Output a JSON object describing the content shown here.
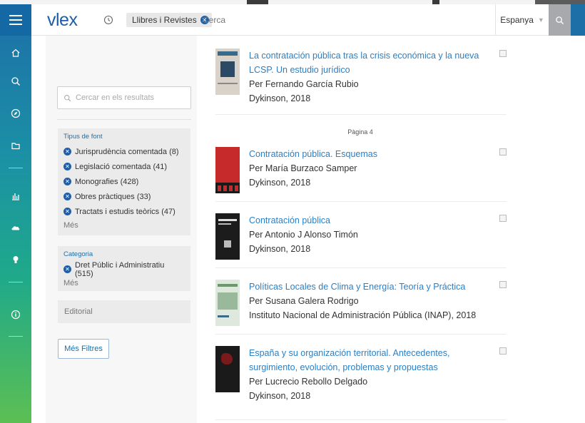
{
  "header": {
    "logo": "vlex",
    "chip_label": "Llibres i Revistes",
    "search_placeholder": "Cerca",
    "country": "Espanya"
  },
  "filters": {
    "search_placeholder": "Cercar en els resultats",
    "source_type": {
      "title": "Tipus de font",
      "items": [
        {
          "label": "Jurisprudència comentada (8)"
        },
        {
          "label": "Legislació comentada (41)"
        },
        {
          "label": "Monografies (428)"
        },
        {
          "label": "Obres pràctiques (33)"
        },
        {
          "label": "Tractats i estudis teòrics (47)"
        }
      ],
      "more": "Més"
    },
    "category": {
      "title": "Categoria",
      "items": [
        {
          "label": "Dret Públic i Administratiu (515)"
        }
      ],
      "more": "Més"
    },
    "editorial": "Editorial",
    "more_filters": "Més Filtres"
  },
  "results": {
    "page_label": "Pàgina 4",
    "items": [
      {
        "title": "La contratación pública tras la crisis económica y la nueva LCSP. Un estudio jurídico",
        "author": "Per Fernando García Rubio",
        "publisher": "Dykinson, 2018"
      },
      {
        "title": "Contratación pública. Esquemas",
        "author": "Per María Burzaco Samper",
        "publisher": "Dykinson, 2018"
      },
      {
        "title": "Contratación pública",
        "author": "Per Antonio J Alonso Timón",
        "publisher": "Dykinson, 2018"
      },
      {
        "title": "Políticas Locales de Clima y Energía: Teoría y Práctica",
        "author": "Per Susana Galera Rodrigo",
        "publisher": "Instituto Nacional de Administración Pública (INAP), 2018"
      },
      {
        "title": "España y su organización territorial. Antecedentes, surgimiento, evolución, problemas y propuestas",
        "author": "Per Lucrecio Rebollo Delgado",
        "publisher": "Dykinson, 2018"
      }
    ]
  },
  "icons": {
    "nav": [
      "home-icon",
      "search-icon",
      "compass-icon",
      "folder-icon",
      "chart-icon",
      "cloud-icon",
      "lightbulb-icon",
      "info-icon"
    ]
  }
}
